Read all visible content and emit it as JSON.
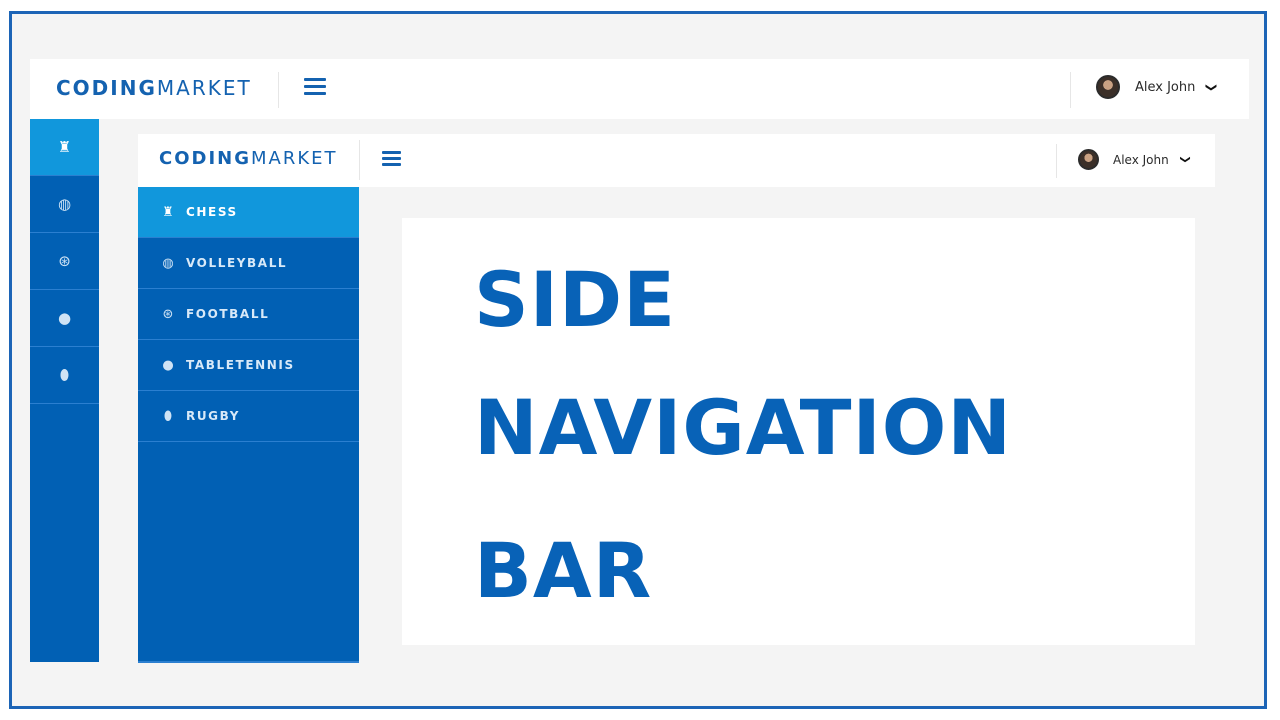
{
  "brand": {
    "strong": "CODING",
    "light": "MARKET"
  },
  "user": {
    "name": "Alex John",
    "chevron": "❯"
  },
  "colors": {
    "primary": "#0160b4",
    "active": "#1197dc",
    "frame": "#1c64b6",
    "headline": "#0862b7"
  },
  "outer_sidebar": {
    "items": [
      {
        "icon": "chess-icon",
        "glyph": "♜",
        "active": true
      },
      {
        "icon": "volleyball-icon",
        "glyph": "◍",
        "active": false
      },
      {
        "icon": "football-icon",
        "glyph": "⊛",
        "active": false
      },
      {
        "icon": "tabletennis-icon",
        "glyph": "●",
        "active": false
      },
      {
        "icon": "rugby-icon",
        "glyph": "⬮",
        "active": false
      }
    ]
  },
  "inner_sidebar": {
    "items": [
      {
        "label": "CHESS",
        "icon": "chess-icon",
        "glyph": "♜",
        "active": true
      },
      {
        "label": "VOLLEYBALL",
        "icon": "volleyball-icon",
        "glyph": "◍",
        "active": false
      },
      {
        "label": "FOOTBALL",
        "icon": "football-icon",
        "glyph": "⊛",
        "active": false
      },
      {
        "label": "TABLETENNIS",
        "icon": "tabletennis-icon",
        "glyph": "●",
        "active": false
      },
      {
        "label": "RUGBY",
        "icon": "rugby-icon",
        "glyph": "⬮",
        "active": false
      }
    ]
  },
  "headline": {
    "line1": "SIDE",
    "line2": "NAVIGATION",
    "line3": "BAR"
  }
}
